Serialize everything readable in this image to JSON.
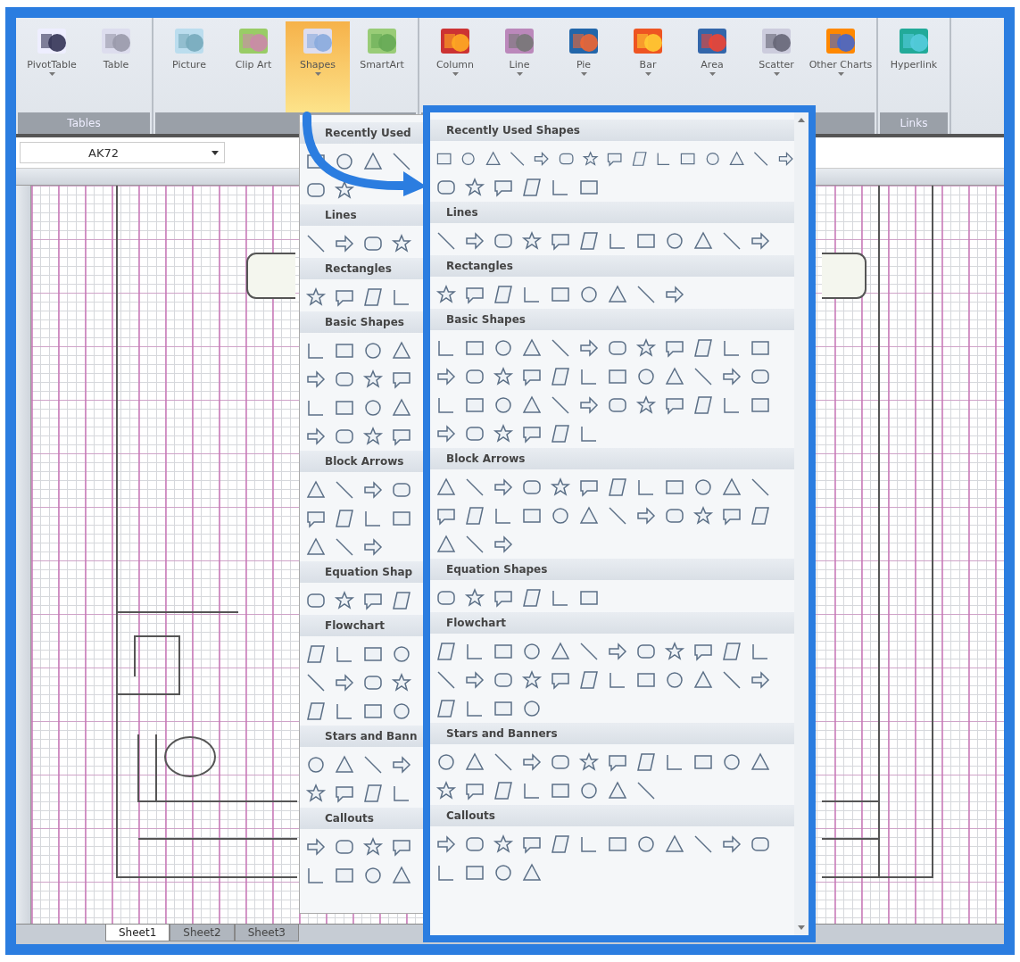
{
  "ribbon": {
    "groups": [
      {
        "label": "Tables",
        "buttons": [
          {
            "label": "PivotTable",
            "selected": false,
            "dropdown": true
          },
          {
            "label": "Table",
            "selected": false,
            "dropdown": false
          }
        ]
      },
      {
        "buttons": [
          {
            "label": "Picture",
            "selected": false,
            "dropdown": false
          },
          {
            "label": "Clip Art",
            "selected": false,
            "dropdown": false
          },
          {
            "label": "Shapes",
            "selected": true,
            "dropdown": true
          },
          {
            "label": "SmartArt",
            "selected": false,
            "dropdown": false
          }
        ]
      },
      {
        "buttons": [
          {
            "label": "Column",
            "selected": false,
            "dropdown": true
          },
          {
            "label": "Line",
            "selected": false,
            "dropdown": true
          },
          {
            "label": "Pie",
            "selected": false,
            "dropdown": true
          },
          {
            "label": "Bar",
            "selected": false,
            "dropdown": true
          },
          {
            "label": "Area",
            "selected": false,
            "dropdown": true
          },
          {
            "label": "Scatter",
            "selected": false,
            "dropdown": true
          },
          {
            "label": "Other Charts",
            "selected": false,
            "dropdown": true
          }
        ]
      },
      {
        "label": "Links",
        "buttons": [
          {
            "label": "Hyperlink",
            "selected": false,
            "dropdown": false
          }
        ]
      }
    ]
  },
  "name_box": {
    "value": "AK72"
  },
  "shapes_menu": {
    "sections": [
      {
        "title": "Recently Used"
      },
      {
        "title": "Lines"
      },
      {
        "title": "Rectangles"
      },
      {
        "title": "Basic Shapes"
      },
      {
        "title": "Block Arrows"
      },
      {
        "title": "Equation Shap"
      },
      {
        "title": "Flowchart"
      },
      {
        "title": "Stars and Bann"
      },
      {
        "title": "Callouts"
      }
    ]
  },
  "shapes_menu_enlarged": {
    "sections": [
      {
        "title": "Recently Used Shapes"
      },
      {
        "title": "Lines"
      },
      {
        "title": "Rectangles"
      },
      {
        "title": "Basic Shapes"
      },
      {
        "title": "Block Arrows"
      },
      {
        "title": "Equation Shapes"
      },
      {
        "title": "Flowchart"
      },
      {
        "title": "Stars and Banners"
      },
      {
        "title": "Callouts"
      }
    ]
  },
  "sheet_tabs": [
    {
      "label": "Sheet1",
      "selected": true
    },
    {
      "label": "Sheet2",
      "selected": false
    },
    {
      "label": "Sheet3",
      "selected": false
    }
  ]
}
